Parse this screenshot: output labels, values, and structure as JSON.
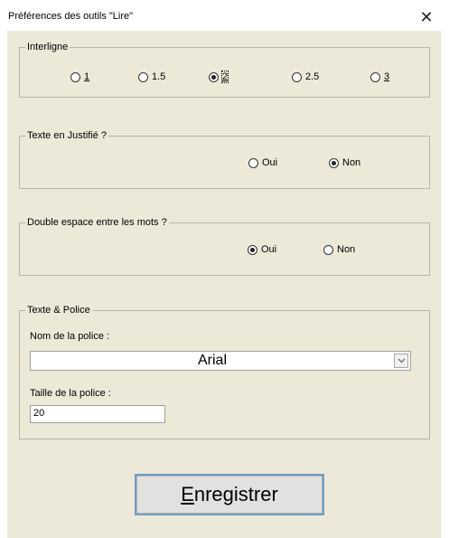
{
  "window": {
    "title": "Préférences des outils \"Lire\"",
    "close": "✕"
  },
  "interligne": {
    "legend": "Interligne",
    "options": [
      {
        "label": "1",
        "selected": false
      },
      {
        "label": "1.5",
        "selected": false
      },
      {
        "label": "2",
        "selected": true
      },
      {
        "label": "2.5",
        "selected": false
      },
      {
        "label": "3",
        "selected": false
      }
    ]
  },
  "justifie": {
    "legend": "Texte en Justifié ?",
    "oui": "Oui",
    "non": "Non",
    "selected": "Non"
  },
  "double_espace": {
    "legend": "Double espace entre les mots ?",
    "oui": "Oui",
    "non": "Non",
    "selected": "Oui"
  },
  "police": {
    "legend": "Texte & Police",
    "nom_label": "Nom de la police :",
    "nom_value": "Arial",
    "taille_label": "Taille de la police :",
    "taille_value": "20"
  },
  "save_button": {
    "prefix": "E",
    "rest": "nregistrer"
  }
}
